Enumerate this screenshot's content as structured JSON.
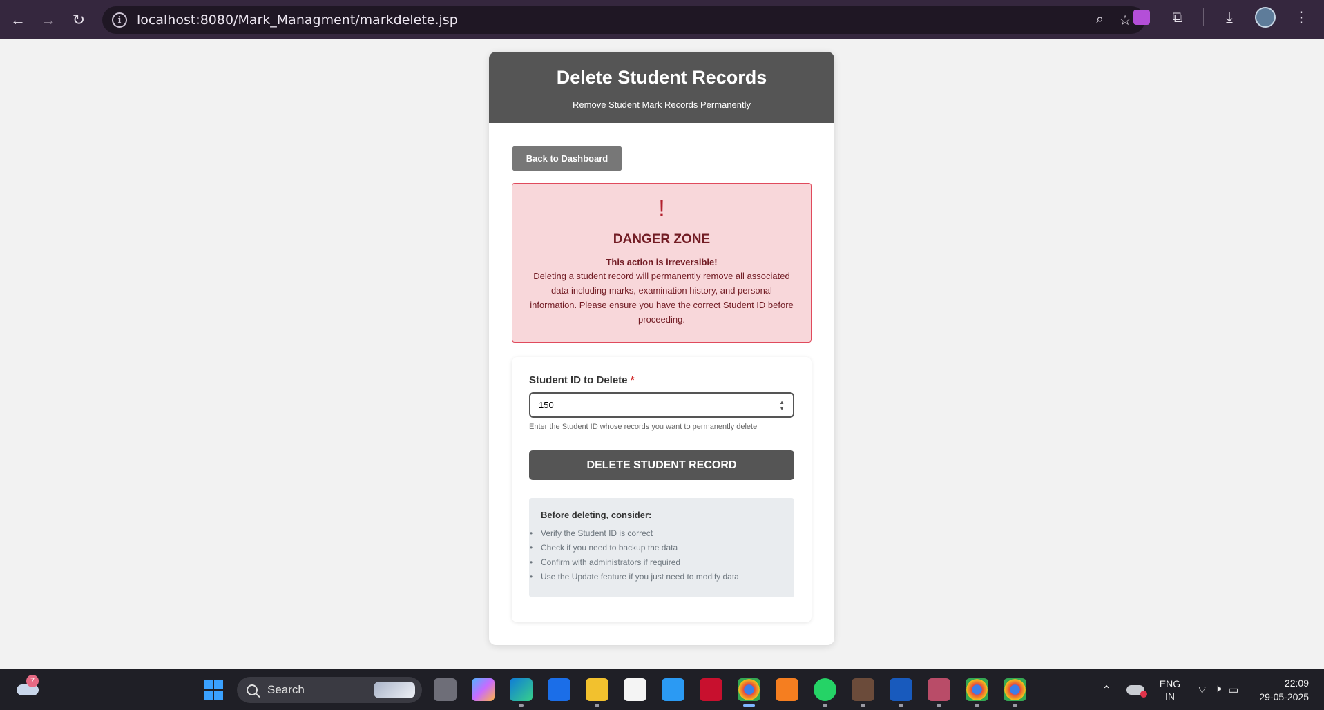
{
  "browser": {
    "url": "localhost:8080/Mark_Managment/markdelete.jsp"
  },
  "page": {
    "title": "Delete Student Records",
    "subtitle": "Remove Student Mark Records Permanently",
    "back_button": "Back to Dashboard"
  },
  "danger": {
    "icon": "!",
    "title": "DANGER ZONE",
    "bold_line": "This action is irreversible!",
    "text": "Deleting a student record will permanently remove all associated data including marks, examination history, and personal information. Please ensure you have the correct Student ID before proceeding."
  },
  "form": {
    "label": "Student ID to Delete",
    "required_mark": "*",
    "value": "150",
    "help": "Enter the Student ID whose records you want to permanently delete",
    "submit": "DELETE STUDENT RECORD"
  },
  "consider": {
    "title": "Before deleting, consider:",
    "items": [
      "Verify the Student ID is correct",
      "Check if you need to backup the data",
      "Confirm with administrators if required",
      "Use the Update feature if you just need to modify data"
    ]
  },
  "taskbar": {
    "weather_badge": "7",
    "search_label": "Search",
    "lang_line1": "ENG",
    "lang_line2": "IN",
    "time": "22:09",
    "date": "29-05-2025"
  },
  "colors": {
    "header": "#555555",
    "danger_bg": "#f8d7da",
    "danger_border": "#e04a5c",
    "danger_text": "#721c24"
  }
}
